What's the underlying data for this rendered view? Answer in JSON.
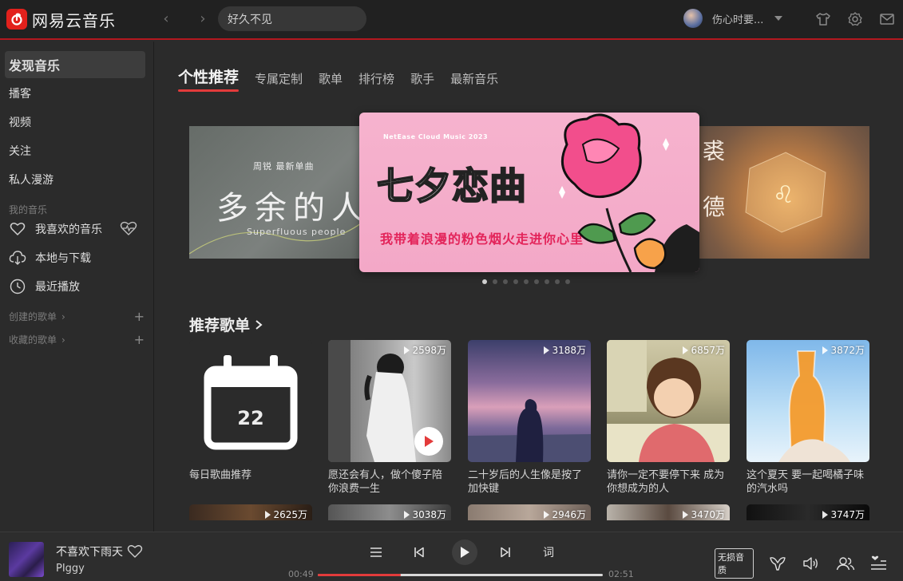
{
  "app": {
    "name": "网易云音乐"
  },
  "search": {
    "value": "好久不见"
  },
  "user": {
    "name": "伤心时要..."
  },
  "sidebar": {
    "items": [
      {
        "label": "发现音乐"
      },
      {
        "label": "播客"
      },
      {
        "label": "视频"
      },
      {
        "label": "关注"
      },
      {
        "label": "私人漫游"
      }
    ],
    "my_music_title": "我的音乐",
    "my_music": [
      {
        "label": "我喜欢的音乐",
        "icon": "heart-icon"
      },
      {
        "label": "本地与下载",
        "icon": "download-icon"
      },
      {
        "label": "最近播放",
        "icon": "clock-icon"
      }
    ],
    "created_playlists": "创建的歌单",
    "collected_playlists": "收藏的歌单"
  },
  "tabs": [
    {
      "label": "个性推荐",
      "active": true
    },
    {
      "label": "专属定制"
    },
    {
      "label": "歌单"
    },
    {
      "label": "排行榜"
    },
    {
      "label": "歌手"
    },
    {
      "label": "最新音乐"
    }
  ],
  "banner": {
    "left": {
      "small": "周锐  最新单曲",
      "big": "多余的人",
      "en": "Superfluous people"
    },
    "center": {
      "small": "NetEase Cloud Music 2023",
      "title": "七夕恋曲",
      "sub": "我带着浪漫的粉色烟火走进你心里"
    },
    "right": {
      "char1": "裘",
      "char2": "德"
    },
    "dots_total": 9,
    "dots_active": 0
  },
  "recommend": {
    "title": "推荐歌单",
    "daily": {
      "day": "22",
      "label": "每日歌曲推荐"
    },
    "playlists": [
      {
        "count": "2598万",
        "title": "愿还会有人，做个傻子陪你浪费一生"
      },
      {
        "count": "3188万",
        "title": "二十岁后的人生像是按了加快键"
      },
      {
        "count": "6857万",
        "title": "请你一定不要停下来 成为你想成为的人"
      },
      {
        "count": "3872万",
        "title": "这个夏天 要一起喝橘子味的汽水吗"
      }
    ],
    "row2_counts": [
      "2625万",
      "3038万",
      "2946万",
      "3470万",
      "3747万"
    ]
  },
  "player": {
    "song": "不喜欢下雨天",
    "artist": "PIggy",
    "current": "00:49",
    "total": "02:51",
    "progress": 0.29,
    "quality": "无损音质",
    "lyric_label": "词"
  },
  "colors": {
    "accent": "#e33b3b",
    "topbar_border": "#b3181f"
  }
}
